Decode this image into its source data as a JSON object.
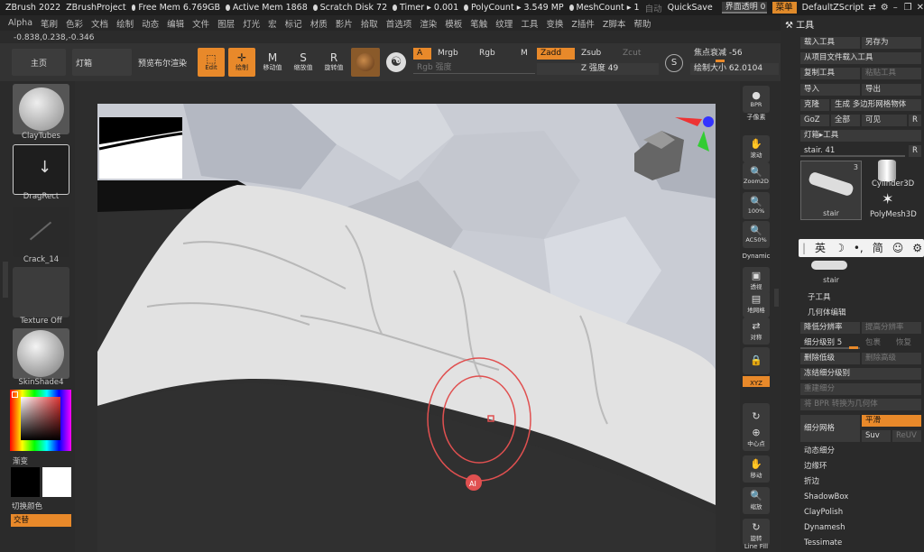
{
  "top": {
    "app": "ZBrush 2022",
    "project": "ZBrushProject",
    "free_mem": "Free Mem 6.769GB",
    "active_mem": "Active Mem 1868",
    "scratch": "Scratch Disk 72",
    "timer": "Timer ▸ 0.001",
    "polycount": "PolyCount ▸ 3.549 MP",
    "meshcount": "MeshCount ▸ 1",
    "auto": "自动",
    "quicksave": "QuickSave",
    "transparency": "界面透明 0",
    "menu_btn": "菜单",
    "script": "DefaultZScript"
  },
  "menus": [
    "Alpha",
    "笔刷",
    "色彩",
    "文档",
    "绘制",
    "动态",
    "编辑",
    "文件",
    "图层",
    "灯光",
    "宏",
    "标记",
    "材质",
    "影片",
    "拾取",
    "首选项",
    "渲染",
    "模板",
    "笔触",
    "纹理",
    "工具",
    "变换",
    "Z插件",
    "Z脚本",
    "帮助"
  ],
  "coords": "-0.838,0.238,-0.346",
  "shelf": {
    "home": "主页",
    "lightbox": "灯箱",
    "preview": "预览布尔渲染",
    "edit": "Edit",
    "draw": "绘制",
    "move": "移动值",
    "scale": "缩放值",
    "rotate": "旋转值",
    "a_label": "A",
    "mrgb": "Mrgb",
    "rgb": "Rgb",
    "m": "M",
    "zadd": "Zadd",
    "zsub": "Zsub",
    "zcut": "Zcut",
    "rgb_intensity": "Rgb 强度",
    "z_intensity": "Z 强度 49",
    "focal": "焦点衰减 -56",
    "draw_size": "绘制大小 62.0104"
  },
  "left": {
    "brush": "ClayTubes",
    "stroke": "DragRect",
    "alpha": "Crack_14",
    "texture": "Texture Off",
    "material": "SkinShade4",
    "gradient": "渐变",
    "switch_color": "切换颜色",
    "alternate": "交替"
  },
  "dock": [
    "BPR",
    "子像素",
    "滚动",
    "Zoom2D",
    "100%",
    "AC50%",
    "Dynamic",
    "透视",
    "地网格",
    "对称",
    "",
    "XYZ",
    "",
    "中心点",
    "移动",
    "缩放",
    "旋转",
    "Line Fill"
  ],
  "tool": {
    "header": "工具",
    "load": "载入工具",
    "save_as": "另存为",
    "load_from_project": "从项目文件载入工具",
    "copy_tool": "复制工具",
    "paste_tool": "粘贴工具",
    "import": "导入",
    "export": "导出",
    "clone": "克隆",
    "make_polymesh": "生成 多边形网格物体",
    "goz": "GoZ",
    "all": "全部",
    "visible": "可见",
    "r": "R",
    "lightbox_tool": "灯箱▸工具",
    "current": "stair. 41",
    "thumb_count": "3",
    "thumb1": "stair",
    "thumb2": "Cylinder3D",
    "thumb3": "PolyMesh3D",
    "thumb4": "stair",
    "subtool": "子工具",
    "geometry": "几何体编辑",
    "lower_res": "降低分辨率",
    "higher_res": "提高分辨率",
    "subdiv_level": "细分级别 5",
    "cage": "包裹",
    "restore": "恢复",
    "del_lower": "删除低级",
    "del_higher": "删除高级",
    "freeze": "冻结细分级别",
    "reconstruct": "重建细分",
    "bpr_convert": "将 BPR 转换为几何体",
    "divide": "细分网格",
    "smooth": "平滑",
    "suv": "Suv",
    "reuv": "ReUV",
    "dynamic_subdiv": "动态细分",
    "edgeloop": "边缘环",
    "crease": "折边",
    "shadowbox": "ShadowBox",
    "claypolish": "ClayPolish",
    "dynamesh": "Dynamesh",
    "tessimate": "Tessimate"
  },
  "ime": [
    "英",
    "☽",
    "•,",
    "简",
    "☺",
    "⚙"
  ],
  "colors": {
    "accent": "#e8892a",
    "panel": "#2a2a2a",
    "viewport": "#2d2d2d"
  }
}
